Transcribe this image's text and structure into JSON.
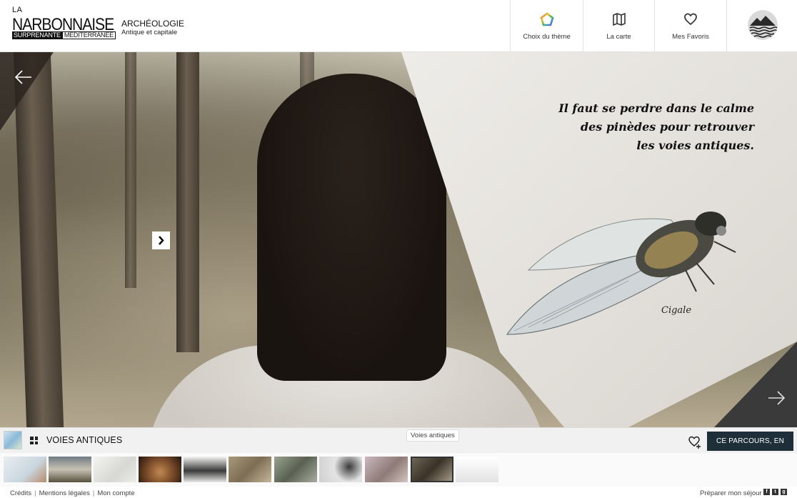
{
  "header": {
    "logo": {
      "la": "LA",
      "main": "NARBONNAISE",
      "sub_a": "SURPRENANTE",
      "sub_b": "MÉDITERRANÉE"
    },
    "theme_title": "ARCHÉOLOGIE",
    "theme_subtitle": "Antique et capitale",
    "nav": {
      "theme": "Choix du thème",
      "map": "La carte",
      "favorites": "Mes Favoris"
    }
  },
  "stage": {
    "quote_lines": [
      "Il faut se perdre dans le calme",
      "des pinèdes pour retrouver",
      "les voies antiques."
    ],
    "illustration_label": "Cigale"
  },
  "bar": {
    "route_title": "VOIES ANTIQUES",
    "tooltip": "Voies antiques",
    "cta": "CE PARCOURS, EN VRAI"
  },
  "footer": {
    "credits": "Crédits",
    "legal": "Mentions légales",
    "account": "Mon compte",
    "prepare": "Préparer mon séjour",
    "separator": "|"
  },
  "thumbnails_count_active": 10,
  "colors": {
    "cta_bg": "#1f2f3a",
    "bar_bg": "#f1f1f1"
  }
}
